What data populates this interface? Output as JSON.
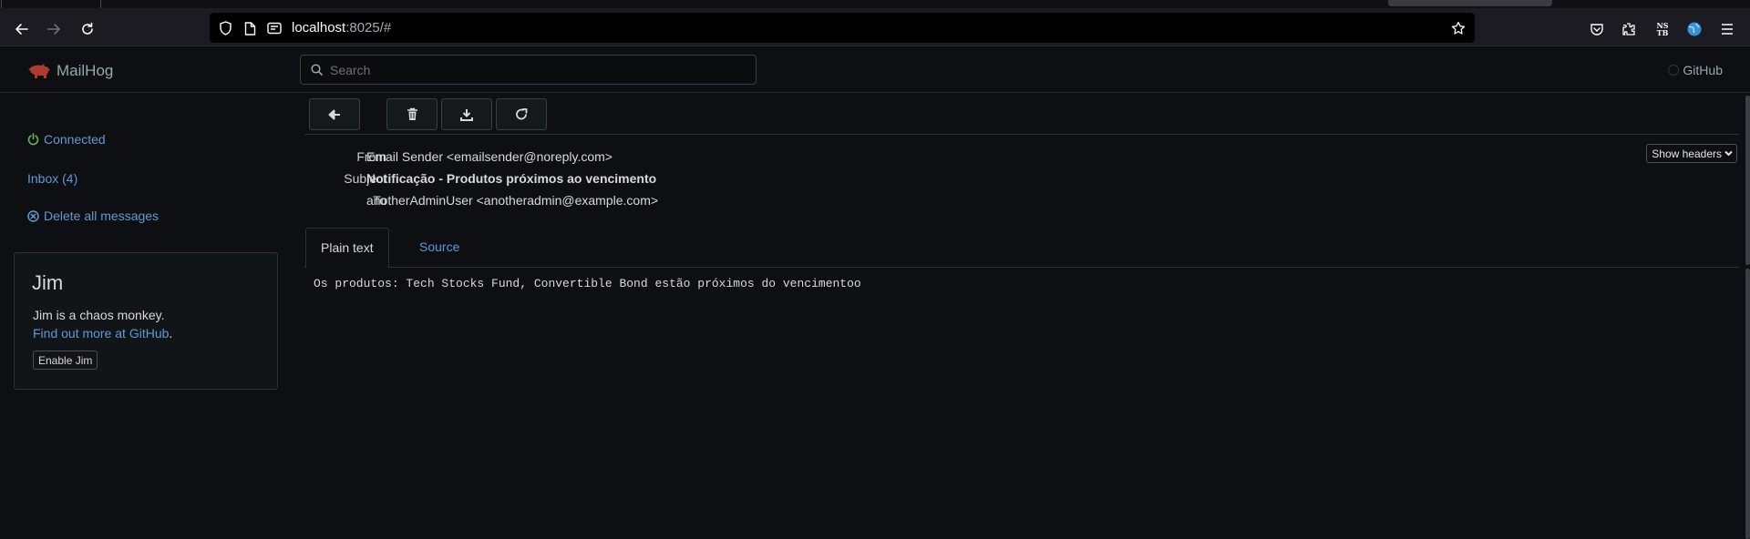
{
  "browser": {
    "url_host": "localhost",
    "url_rest": ":8025/#",
    "nst_label_top": "NS",
    "nst_label_bottom": "TB"
  },
  "app": {
    "brand": "MailHog",
    "search_placeholder": "Search",
    "github_label": "GitHub"
  },
  "sidebar": {
    "connected": "Connected",
    "inbox": "Inbox (4)",
    "delete_all": "Delete all messages",
    "jim": {
      "title": "Jim",
      "description": "Jim is a chaos monkey.",
      "link_text": "Find out more at GitHub",
      "link_suffix": ".",
      "button": "Enable Jim"
    }
  },
  "message": {
    "from_label": "From",
    "from_value": "Email Sender <emailsender@noreply.com>",
    "subject_label": "Subject",
    "subject_value": "Notificação - Produtos próximos ao vencimento",
    "to_label": "To",
    "to_value": "anotherAdminUser <anotheradmin@example.com>",
    "show_headers": "Show headers",
    "tabs": [
      "Plain text",
      "Source"
    ],
    "body": "Os produtos: Tech Stocks Fund, Convertible Bond estão próximos do vencimentoo"
  },
  "colors": {
    "accent_link": "#5b9bd5",
    "connected_green": "#5cb85c",
    "brand_pig": "#b03a2e"
  }
}
